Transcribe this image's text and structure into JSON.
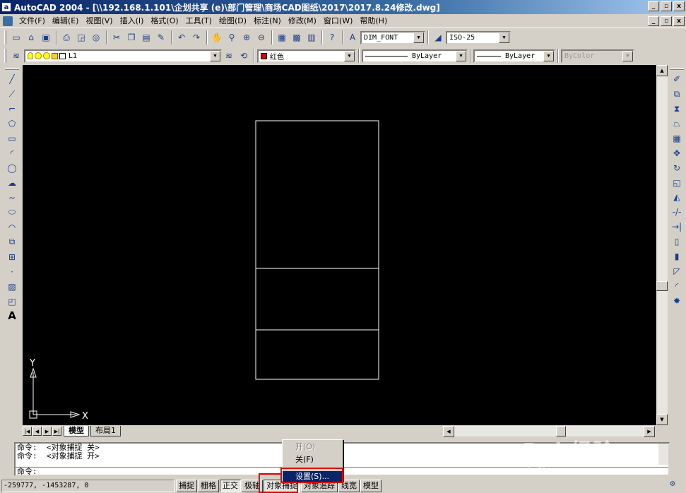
{
  "window": {
    "app_icon": "a",
    "title": "AutoCAD 2004 - [\\\\192.168.1.101\\企划共享 (e)\\部门管理\\商场CAD图纸\\2017\\2017.8.24修改.dwg]",
    "buttons": [
      "_",
      "▫",
      "x"
    ]
  },
  "menu": {
    "items": [
      "文件(F)",
      "编辑(E)",
      "视图(V)",
      "插入(I)",
      "格式(O)",
      "工具(T)",
      "绘图(D)",
      "标注(N)",
      "修改(M)",
      "窗口(W)",
      "帮助(H)"
    ]
  },
  "toolbar1": {
    "icons": [
      "new-icon",
      "open-icon",
      "save-icon",
      "print-icon",
      "preview-icon",
      "publish-icon",
      "cut-icon",
      "copy-icon",
      "paste-icon",
      "matchprop-icon",
      "undo-icon",
      "redo-icon",
      "pan-icon",
      "zoom-realtime-icon",
      "zoom-window-icon",
      "zoom-previous-icon",
      "properties-icon",
      "designcenter-icon",
      "toolpalette-icon",
      "help-icon"
    ],
    "text_style": "DIM_FONT",
    "dim_style": "ISO-25"
  },
  "toolbar2": {
    "layer_name": "L1",
    "color_label": "红色",
    "linetype": "ByLayer",
    "lineweight": "ByLayer",
    "plotstyle": "ByColor",
    "colors": {
      "layer_color": "#e00000"
    }
  },
  "left_tools": [
    "line-icon",
    "construction-line-icon",
    "polyline-icon",
    "polygon-icon",
    "rectangle-icon",
    "arc-icon",
    "circle-icon",
    "revcloud-icon",
    "spline-icon",
    "ellipse-icon",
    "ellipse-arc-icon",
    "insert-block-icon",
    "make-block-icon",
    "point-icon",
    "hatch-icon",
    "region-icon",
    "mtext-icon"
  ],
  "left_tool_text": "A",
  "right_tools": [
    "erase-icon",
    "copy-object-icon",
    "mirror-icon",
    "offset-icon",
    "array-icon",
    "move-icon",
    "rotate-icon",
    "scale-icon",
    "stretch-icon",
    "trim-icon",
    "extend-icon",
    "break-icon",
    "join-icon",
    "chamfer-icon",
    "fillet-icon",
    "explode-icon"
  ],
  "drawing": {
    "ucs": {
      "x_label": "X",
      "y_label": "Y"
    }
  },
  "tabs": {
    "nav": [
      "|◀",
      "◀",
      "▶",
      "▶|"
    ],
    "items": [
      "模型",
      "布局1"
    ]
  },
  "command": {
    "history": [
      "命令:  <对象捕捉 关>",
      "命令:  <对象捕捉 开>"
    ],
    "prompt": "命令:"
  },
  "status": {
    "coords": "-259777, -1453287, 0",
    "buttons": [
      "捕捉",
      "栅格",
      "正交",
      "极轴",
      "对象捕捉",
      "对象追踪",
      "线宽",
      "模型"
    ]
  },
  "context_menu": {
    "items": [
      "开(O)",
      "关(F)",
      "设置(S)..."
    ]
  },
  "watermark": {
    "text": "Bai 经验",
    "sub": "jingyan.baidu.com"
  }
}
